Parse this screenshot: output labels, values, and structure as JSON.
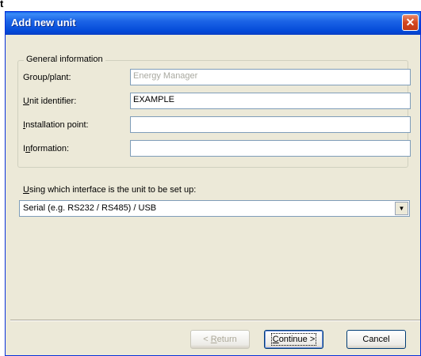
{
  "window": {
    "title": "Add new unit",
    "close_glyph": "✕"
  },
  "stray_char": "t",
  "general": {
    "legend": "General information",
    "group_label": "Group/plant:",
    "group_value": "Energy Manager",
    "unit_label": "Unit identifier:",
    "unit_value": "EXAMPLE",
    "install_label": "Installation point:",
    "install_value": "",
    "info_label": "Information:",
    "info_value": ""
  },
  "interface": {
    "question": "Using which interface is the unit to be set up:",
    "selected": "Serial (e.g. RS232 / RS485) / USB"
  },
  "buttons": {
    "return": "< Return",
    "continue": "Continue >",
    "cancel": "Cancel"
  }
}
